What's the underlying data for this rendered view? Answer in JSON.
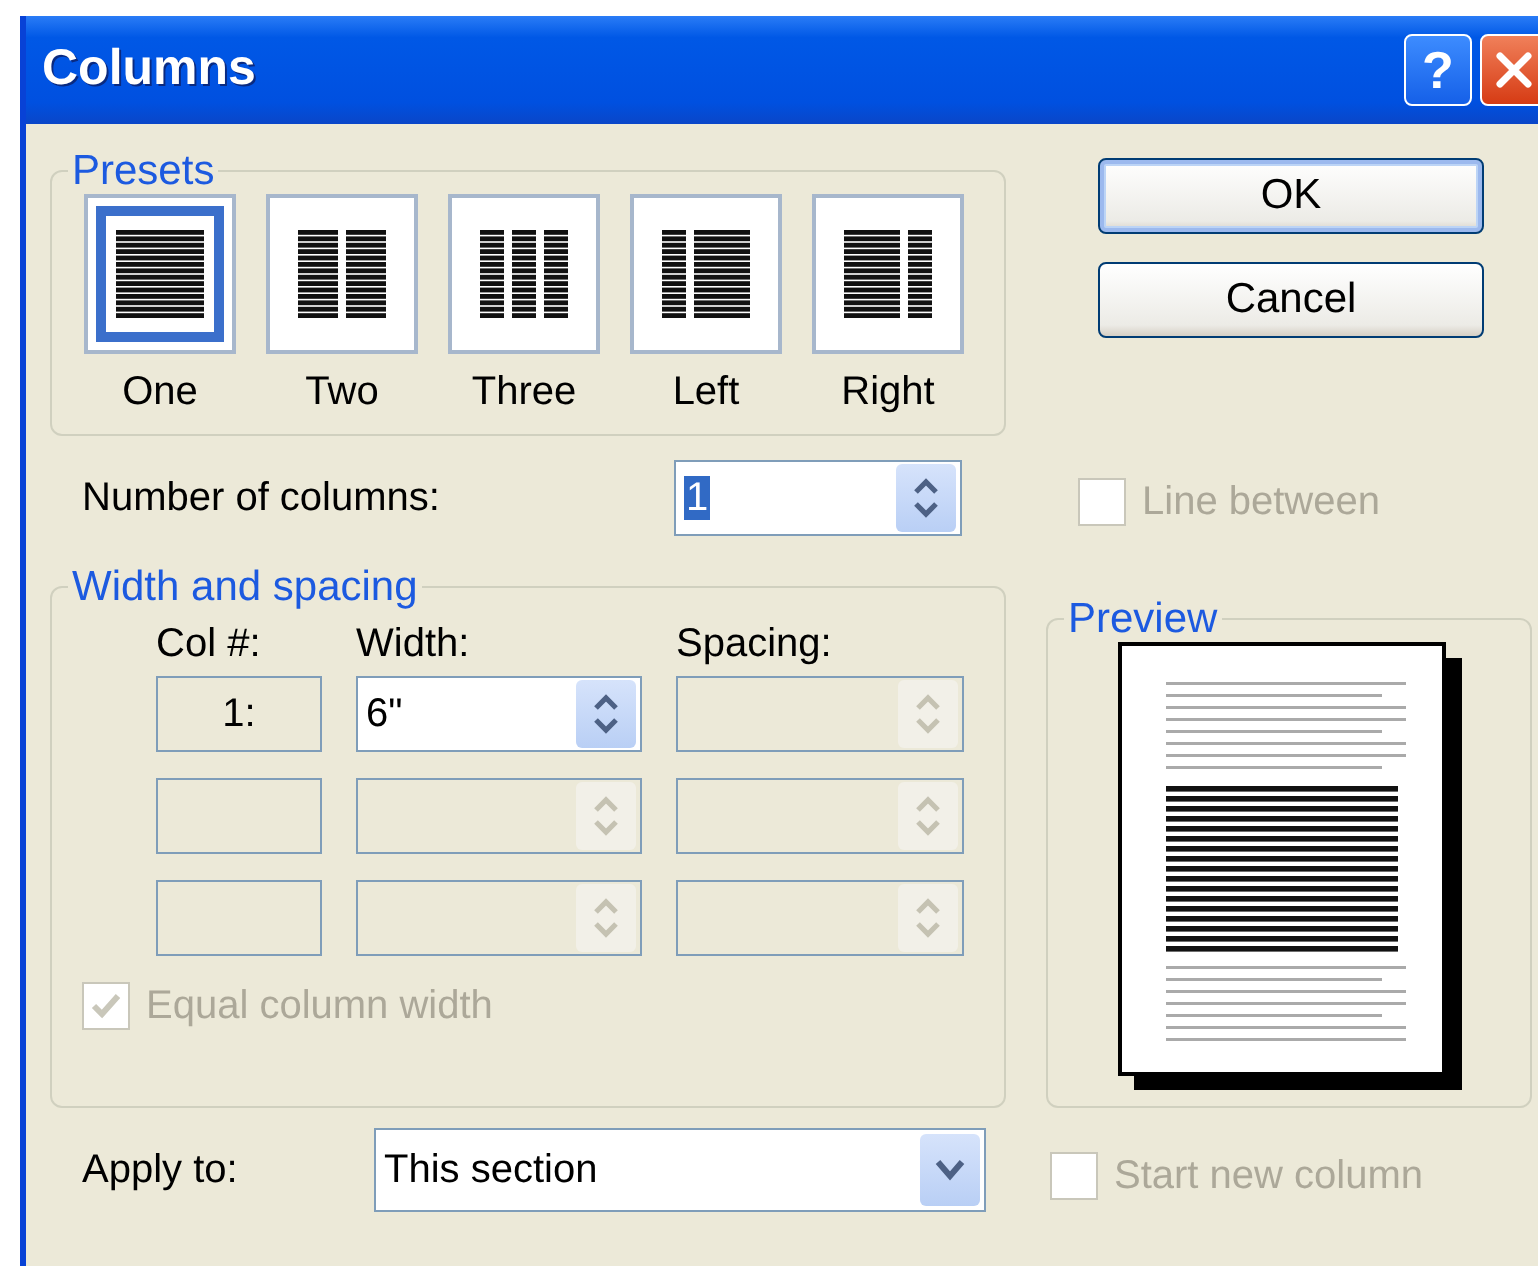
{
  "window": {
    "title": "Columns",
    "controls": [
      {
        "kind": "help",
        "glyph": "?"
      },
      {
        "kind": "close"
      }
    ]
  },
  "presets": {
    "label": "Presets",
    "items": [
      {
        "label": "One",
        "kind": "one",
        "selected": true
      },
      {
        "label": "Two",
        "kind": "two",
        "selected": false
      },
      {
        "label": "Three",
        "kind": "three",
        "selected": false
      },
      {
        "label": "Left",
        "kind": "left",
        "selected": false
      },
      {
        "label": "Right",
        "kind": "right",
        "selected": false
      }
    ]
  },
  "buttons": [
    {
      "label": "OK",
      "default": true
    },
    {
      "label": "Cancel",
      "default": false
    }
  ],
  "number_of_columns": {
    "label": "Number of columns:",
    "value": "1",
    "text_selected": true
  },
  "line_between": {
    "label": "Line between",
    "checked": false,
    "disabled": true
  },
  "width_and_spacing": {
    "label": "Width and spacing",
    "headers": [
      "Col #:",
      "Width:",
      "Spacing:"
    ],
    "rows": [
      {
        "col": "1:",
        "width": "6\"",
        "width_disabled": false,
        "spacing_disabled": true
      },
      {
        "width_disabled": true,
        "spacing_disabled": true
      },
      {
        "width_disabled": true,
        "spacing_disabled": true
      }
    ]
  },
  "equal_column_width": {
    "label": "Equal column width",
    "checked": true,
    "disabled": true
  },
  "preview": {
    "label": "Preview"
  },
  "apply_to": {
    "label": "Apply to:",
    "value": "This section"
  },
  "start_new_column": {
    "label": "Start new column",
    "checked": false,
    "disabled": true
  }
}
